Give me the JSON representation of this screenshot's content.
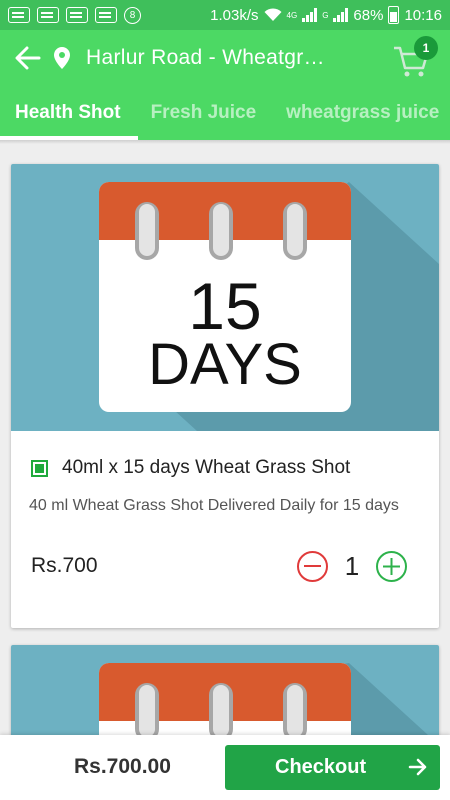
{
  "status_bar": {
    "speed": "1.03k/s",
    "network": "4G",
    "network2": "G",
    "battery": "68%",
    "time": "10:16",
    "notification_count": "8"
  },
  "toolbar": {
    "location": "Harlur Road - Wheatgrass Delivery",
    "cart_count": "1"
  },
  "tabs": [
    {
      "label": "Health Shot",
      "active": true
    },
    {
      "label": "Fresh Juice",
      "active": false
    },
    {
      "label": "wheatgrass juice",
      "active": false
    }
  ],
  "products": [
    {
      "calendar_number": "15",
      "calendar_unit": "DAYS",
      "name": "40ml x 15 days Wheat Grass Shot",
      "description": "40 ml Wheat Grass Shot Delivered Daily for 15 days",
      "price": "Rs.700",
      "quantity": "1"
    }
  ],
  "footer": {
    "total": "Rs.700.00",
    "checkout_label": "Checkout"
  },
  "colors": {
    "primary": "#4cd964",
    "checkout": "#21a447",
    "calendar_top": "#d85a2e",
    "image_bg": "#6db1c2",
    "minus": "#e03a3a",
    "plus": "#2db24b"
  }
}
